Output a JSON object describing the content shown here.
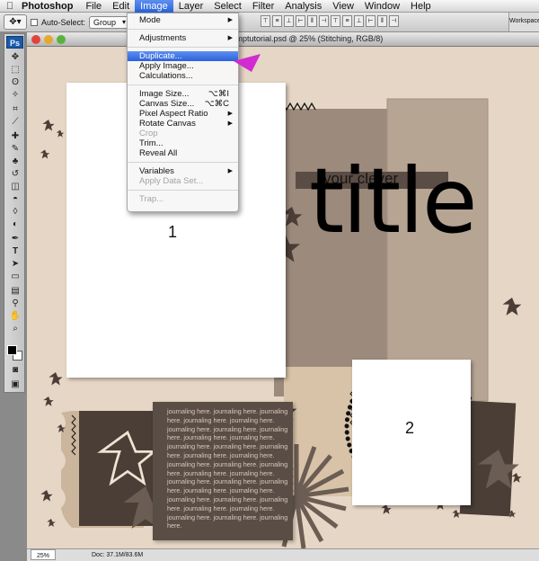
{
  "menubar": {
    "app_name": "Photoshop",
    "items": [
      "File",
      "Edit",
      "Image",
      "Layer",
      "Select",
      "Filter",
      "Analysis",
      "View",
      "Window",
      "Help"
    ]
  },
  "options_bar": {
    "auto_select_label": "Auto-Select:",
    "auto_select_value": "Group",
    "workspace_label": "Workspace"
  },
  "tools_panel": {
    "logo": "Ps"
  },
  "document": {
    "title": "...mptutorial.psd @ 25% (Stitching, RGB/8)",
    "zoom": "25%",
    "doc_size": "Doc: 37.1M/83.6M",
    "photo1_number": "1",
    "photo2_number": "2",
    "subtitle_text": "your clever",
    "title_text": "title",
    "journal_text": "journaling here. journaling here. journaling here. journaling here. journaling here. journaling here. journaling here. journaling here. journaling here. journaling here. journaling here. journaling here. journaling here. journaling here. journaling here. journaling here. journaling here. journaling here. journaling here. journaling here. journaling here. journaling here. journaling here. journaling here. journaling here. journaling here. journaling here. journaling here. journaling here. journaling here. journaling here. journaling here. journaling here."
  },
  "image_menu": {
    "mode": "Mode",
    "adjustments": "Adjustments",
    "duplicate": "Duplicate...",
    "apply_image": "Apply Image...",
    "calculations": "Calculations...",
    "image_size": "Image Size...",
    "image_size_shortcut": "⌥⌘I",
    "canvas_size": "Canvas Size...",
    "canvas_size_shortcut": "⌥⌘C",
    "pixel_aspect_ratio": "Pixel Aspect Ratio",
    "rotate_canvas": "Rotate Canvas",
    "crop": "Crop",
    "trim": "Trim...",
    "reveal_all": "Reveal All",
    "variables": "Variables",
    "apply_data_set": "Apply Data Set...",
    "trap": "Trap..."
  },
  "colors": {
    "canvas_bg": "#e6d6c5",
    "dark_brown": "#4a3e37",
    "mid_brown": "#9c8a7c",
    "light_brown": "#b7a594",
    "highlight": "#2c62d8",
    "pointer": "#d12bd1"
  }
}
